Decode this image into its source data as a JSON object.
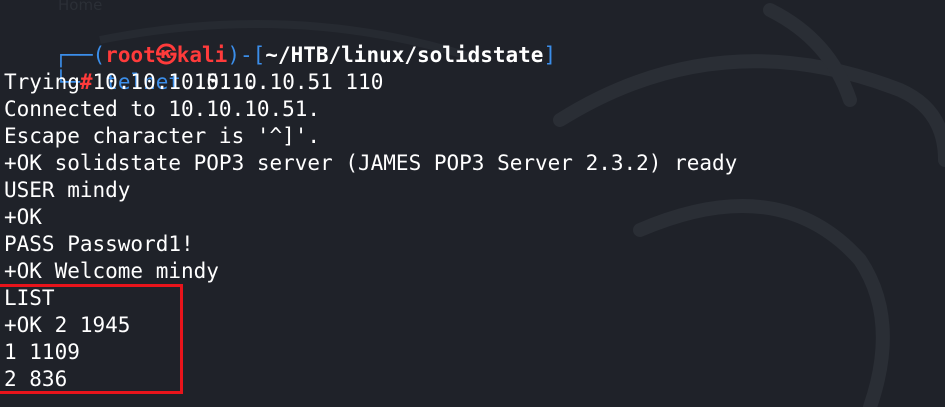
{
  "prompt": {
    "corner_top": "┌──",
    "corner_bottom": "└─",
    "open_paren": "(",
    "user": "root",
    "skull": "㉿",
    "host": "kali",
    "close_paren": ")",
    "dash": "-",
    "open_bracket": "[",
    "path": "~/HTB/linux/solidstate",
    "close_bracket": "]",
    "hash": "#",
    "command": "telnet",
    "args": " 10.10.10.51 110"
  },
  "output_lines": [
    "Trying 10.10.10.51...",
    "Connected to 10.10.10.51.",
    "Escape character is '^]'.",
    "+OK solidstate POP3 server (JAMES POP3 Server 2.3.2) ready",
    "USER mindy",
    "+OK",
    "PASS Password1!",
    "+OK Welcome mindy",
    "LIST",
    "+OK 2 1945",
    "1 1109",
    "2 836"
  ],
  "background_ghost_text": {
    "home": "Home"
  },
  "colors": {
    "background": "#1f2229",
    "prompt_blue": "#3b8eea",
    "prompt_red": "#ff3b3b",
    "text": "#ffffff",
    "highlight_border": "#e8141b"
  },
  "icons": {
    "background": "kali-dragon-wallpaper"
  }
}
